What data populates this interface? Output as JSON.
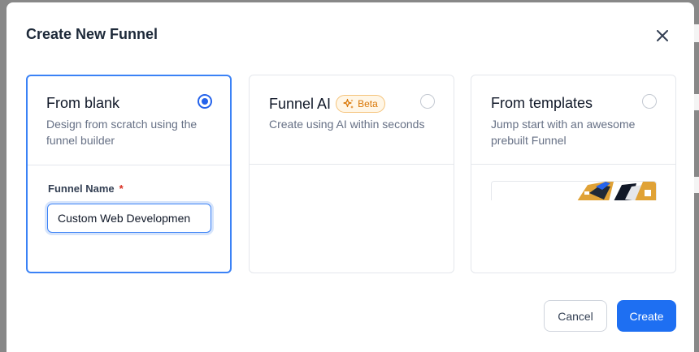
{
  "dialog": {
    "title": "Create New Funnel",
    "close_icon": "close-icon"
  },
  "options": [
    {
      "title": "From blank",
      "description": "Design from scratch using the funnel builder",
      "selected": true
    },
    {
      "title": "Funnel AI",
      "badge": "Beta",
      "badge_icon": "sparkle-icon",
      "description": "Create using AI within seconds",
      "selected": false
    },
    {
      "title": "From templates",
      "description": "Jump start with an awesome prebuilt Funnel",
      "selected": false
    }
  ],
  "form": {
    "funnel_name_label": "Funnel Name",
    "required_mark": "*",
    "funnel_name_value": "Custom Web Developmen"
  },
  "footer": {
    "cancel_label": "Cancel",
    "create_label": "Create"
  },
  "colors": {
    "primary": "#1e6ff2",
    "selected_border": "#3b82f6",
    "beta_badge": "#d97706",
    "required": "#d92d20"
  }
}
